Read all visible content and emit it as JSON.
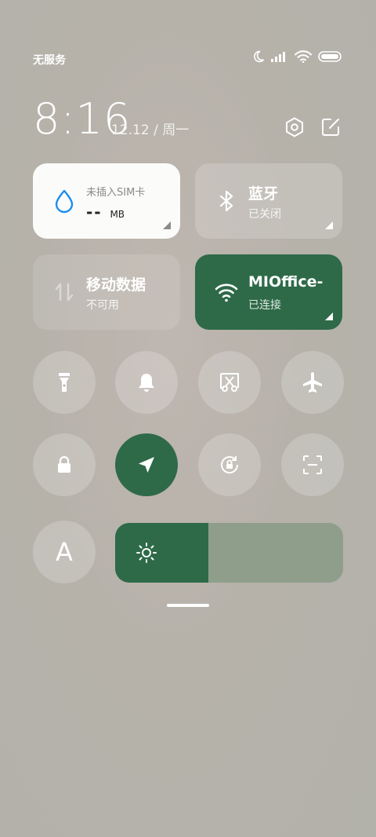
{
  "status_bar": {
    "carrier": "无服务",
    "icons": [
      "moon-icon",
      "signal-icon",
      "wifi-icon",
      "battery-icon"
    ]
  },
  "header": {
    "time": "8:16",
    "date": "12.12 / 周一",
    "icons": [
      "settings-icon",
      "edit-icon"
    ]
  },
  "tiles": {
    "data_usage": {
      "title": "未插入SIM卡",
      "value": "--",
      "unit": "MB",
      "icon": "water-drop-icon"
    },
    "bluetooth": {
      "title": "蓝牙",
      "status": "已关闭",
      "icon": "bluetooth-icon"
    },
    "mobile_data": {
      "title": "移动数据",
      "status": "不可用",
      "icon": "mobile-data-icon"
    },
    "wifi": {
      "title": "MIOffice-",
      "status": "已连接",
      "icon": "wifi-icon"
    }
  },
  "toggles_row1": [
    {
      "name": "flashlight",
      "icon": "flashlight-icon",
      "active": false
    },
    {
      "name": "ringer",
      "icon": "bell-icon",
      "active": false
    },
    {
      "name": "screenshot",
      "icon": "screenshot-icon",
      "active": false
    },
    {
      "name": "airplane-mode",
      "icon": "airplane-icon",
      "active": false
    }
  ],
  "toggles_row2": [
    {
      "name": "lock-screen",
      "icon": "lock-icon",
      "active": false
    },
    {
      "name": "location",
      "icon": "location-arrow-icon",
      "active": true
    },
    {
      "name": "rotation-lock",
      "icon": "rotation-lock-icon",
      "active": false
    },
    {
      "name": "scanner",
      "icon": "scan-icon",
      "active": false
    }
  ],
  "auto_brightness": {
    "label": "A",
    "icon": "font-size-icon"
  },
  "brightness": {
    "level": 0.41,
    "icon": "sun-icon"
  },
  "colors": {
    "accent": "#2e6a48",
    "slider_track": "#8e9e8a",
    "white": "#ffffff"
  }
}
